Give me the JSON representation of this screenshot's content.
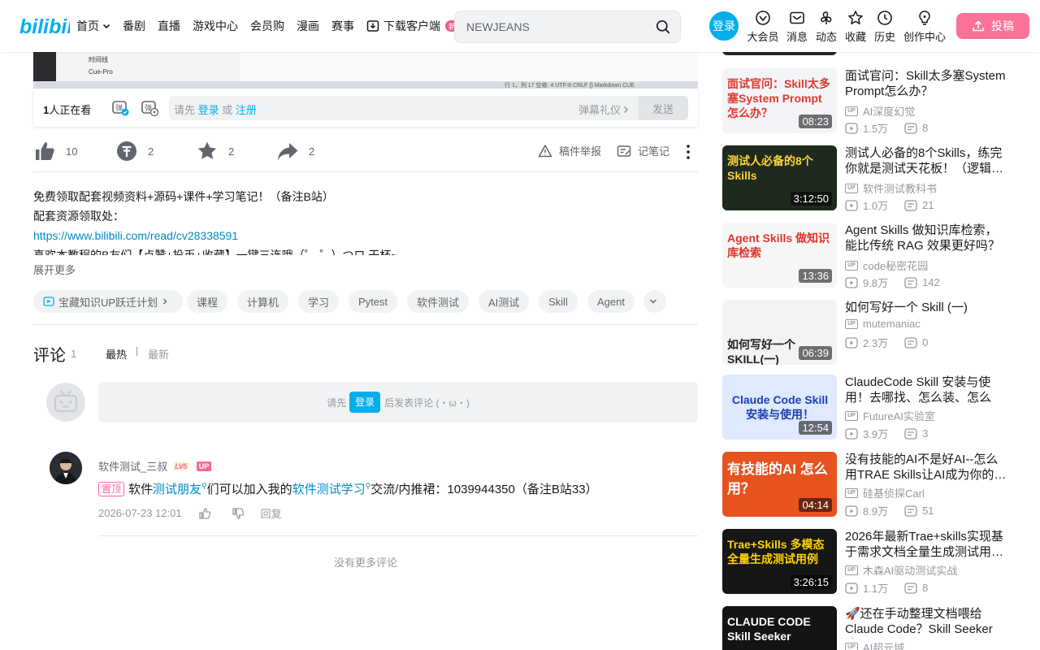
{
  "header": {
    "logo_text": "bilibili",
    "nav": [
      {
        "label": "首页"
      },
      {
        "label": "番剧"
      },
      {
        "label": "直播"
      },
      {
        "label": "游戏中心"
      },
      {
        "label": "会员购"
      },
      {
        "label": "漫画"
      },
      {
        "label": "赛事"
      }
    ],
    "download_label": "下载客户端",
    "download_badge": "新",
    "search": {
      "value": "NEWJEANS"
    },
    "login_label": "登录",
    "entries": [
      "大会员",
      "消息",
      "动态",
      "收藏",
      "历史",
      "创作中心"
    ],
    "upload_label": "投稿"
  },
  "player": {
    "sidebar_lines": [
      "时间线",
      "Cue-Pro"
    ],
    "status_text": "行 1，列 17   空格: 4   UTF-8   CRLF   {}   Markdown   CUE",
    "viewers_count": "1",
    "viewers_suffix": "人正在看",
    "danmaku_hint_prefix": "请先",
    "danmaku_login": "登录",
    "danmaku_or": "或",
    "danmaku_register": "注册",
    "danmaku_etiquette": "弹幕礼仪",
    "send_label": "发送"
  },
  "toolbar": {
    "like_count": "10",
    "coin_count": "2",
    "fav_count": "2",
    "share_count": "2",
    "report_label": "稿件举报",
    "note_label": "记笔记"
  },
  "description": {
    "line1": "免费领取配套视频资料+源码+课件+学习笔记！（备注B站）",
    "line2": "配套资源领取处：",
    "link": "https://www.bilibili.com/read/cv28338591",
    "line4": "喜欢本教程的B友们【点赞+投币+收藏】一键三连哦（゜-゜）つロ 干杯~",
    "expand_label": "展开更多"
  },
  "tags": [
    "宝藏知识UP跃迁计划",
    "课程",
    "计算机",
    "学习",
    "Pytest",
    "软件测试",
    "AI测试",
    "Skill",
    "Agent"
  ],
  "comments": {
    "title": "评论",
    "count": "1",
    "sort_hot": "最热",
    "sort_new": "最新",
    "reply_prefix": "请先",
    "reply_login": "登录",
    "reply_suffix": "后发表评论 (・ω・)",
    "items": [
      {
        "user": "软件测试_三叔",
        "level": "LV5",
        "up_badge": "UP",
        "pin": "置顶",
        "text_a": "软件",
        "link_a": "测试朋友",
        "text_b": "们可以加入我的",
        "link_b": "软件测试学习",
        "text_c": "交流/内推裙：1039944350（备注B站33）",
        "time": "2026-07-23 12:01",
        "reply_label": "回复"
      }
    ],
    "no_more": "没有更多评论"
  },
  "recommendations": [
    {
      "title": "面试官问：Skill太多塞System Prompt怎么办？",
      "author": "AI深度幻觉",
      "views": "1.5万",
      "danmaku": "8",
      "duration": "08:23",
      "thumb_text": "面试官问：Skill太多塞System Prompt怎么办？",
      "thumb_bg": "#f2f4f8",
      "thumb_color": "#e03a2f"
    },
    {
      "title": "测试人必备的8个Skills，练完你就是测试天花板！（逻辑…",
      "author": "软件测试教科书",
      "views": "1.0万",
      "danmaku": "21",
      "duration": "3:12:50",
      "thumb_text": "测试人必备的8个Skills",
      "thumb_bg": "#1f2a1f",
      "thumb_color": "#ffd23a"
    },
    {
      "title": "Agent Skills 做知识库检索，能比传统 RAG 效果更好吗？",
      "author": "code秘密花园",
      "views": "9.8万",
      "danmaku": "142",
      "duration": "13:36",
      "thumb_text": "Agent Skills 做知识库检索",
      "thumb_bg": "#f6f6f6",
      "thumb_color": "#e0342a"
    },
    {
      "title": "如何写好一个 Skill (一)",
      "author": "mutemaniac",
      "views": "2.3万",
      "danmaku": "0",
      "duration": "06:39",
      "thumb_text": "如何写好一个SKILL(一)",
      "thumb_bg": "#f3f3f3",
      "thumb_color": "#222222"
    },
    {
      "title": "ClaudeCode Skill 安装与使用！去哪找、怎么装、怎么用…",
      "author": "FutureAI实验室",
      "views": "3.9万",
      "danmaku": "3",
      "duration": "12:54",
      "thumb_text": "Claude Code Skill 安装与使用！",
      "thumb_bg": "#dfe9ff",
      "thumb_color": "#1b3fb3"
    },
    {
      "title": "没有技能的AI不是好AI--怎么用TRAE Skills让AI成为你的…",
      "author": "硅基侦探Carl",
      "views": "8.9万",
      "danmaku": "51",
      "duration": "04:14",
      "thumb_text": "有技能的AI 怎么用？",
      "thumb_bg": "#e8521f",
      "thumb_color": "#ffffff"
    },
    {
      "title": "2026年最新Trae+skills实现基于需求文档全量生成测试用…",
      "author": "木森AI驱动测试实战",
      "views": "1.1万",
      "danmaku": "8",
      "duration": "3:26:15",
      "thumb_text": "Trae+Skills 多模态全量生成测试用例",
      "thumb_bg": "#161616",
      "thumb_color": "#ffd200"
    },
    {
      "title": "🚀还在手动整理文档喂给Claude Code？Skill Seeker让…",
      "author": "AI超元域",
      "views": "",
      "danmaku": "",
      "duration": "",
      "thumb_text": "CLAUDE CODE Skill Seeker",
      "thumb_bg": "#141414",
      "thumb_color": "#ffffff"
    }
  ]
}
